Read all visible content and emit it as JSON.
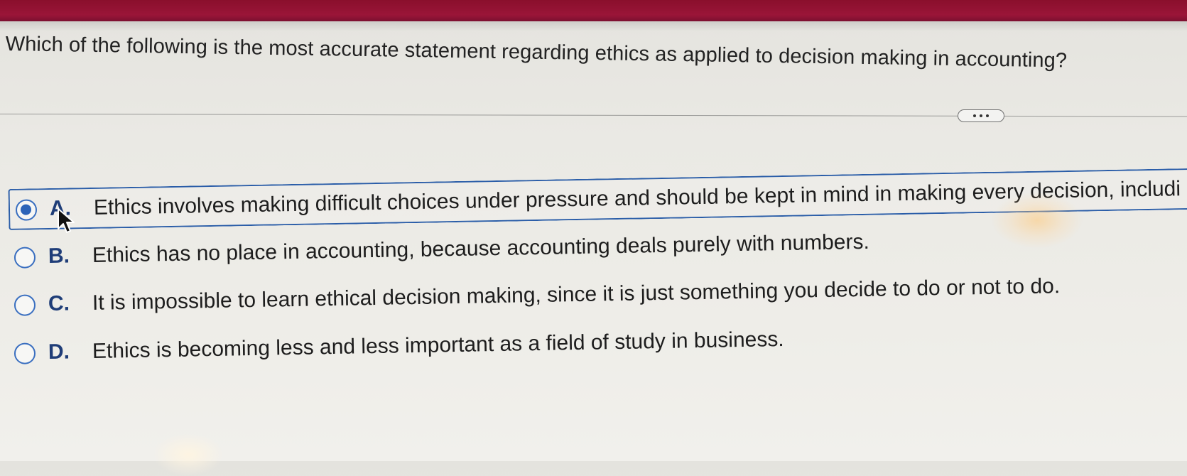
{
  "question": {
    "text": "Which of the following is the most accurate statement regarding ethics as applied to decision making in accounting?"
  },
  "more_button": {
    "icon": "ellipsis-icon"
  },
  "options": [
    {
      "letter": "A.",
      "text": "Ethics involves making difficult choices under pressure and should be kept in mind in making every decision, includi",
      "selected": true
    },
    {
      "letter": "B.",
      "text": "Ethics has no place in accounting, because accounting deals purely with numbers.",
      "selected": false
    },
    {
      "letter": "C.",
      "text": "It is impossible to learn ethical decision making, since it is just something you decide to do or not to do.",
      "selected": false
    },
    {
      "letter": "D.",
      "text": "Ethics is becoming less and less important as a field of study in business.",
      "selected": false
    }
  ],
  "colors": {
    "header_bar": "#8a0f2c",
    "selection_border": "#2a5da8",
    "radio_fill": "#2d64b8",
    "letter_color": "#1f3d78"
  }
}
